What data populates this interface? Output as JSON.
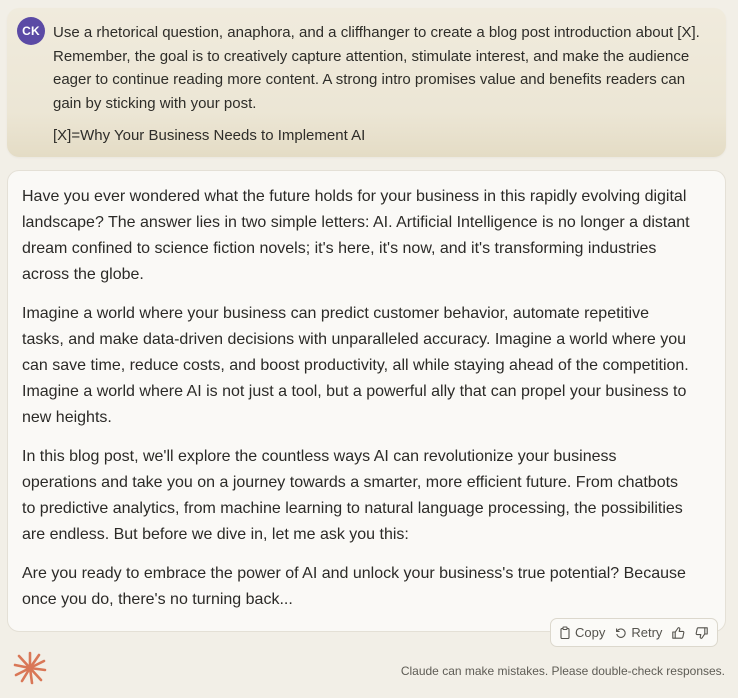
{
  "user": {
    "initials": "CK",
    "paragraphs": [
      "Use a rhetorical question, anaphora, and a cliffhanger to create a blog post introduction about [X]. Remember, the goal is to creatively capture attention, stimulate interest, and make the audience eager to continue reading more content. A strong intro promises value and benefits readers can gain by sticking with your post.",
      "[X]=Why Your Business Needs to Implement AI"
    ]
  },
  "assistant": {
    "paragraphs": [
      "Have you ever wondered what the future holds for your business in this rapidly evolving digital landscape? The answer lies in two simple letters: AI. Artificial Intelligence is no longer a distant dream confined to science fiction novels; it's here, it's now, and it's transforming industries across the globe.",
      "Imagine a world where your business can predict customer behavior, automate repetitive tasks, and make data-driven decisions with unparalleled accuracy. Imagine a world where you can save time, reduce costs, and boost productivity, all while staying ahead of the competition. Imagine a world where AI is not just a tool, but a powerful ally that can propel your business to new heights.",
      "In this blog post, we'll explore the countless ways AI can revolutionize your business operations and take you on a journey towards a smarter, more efficient future. From chatbots to predictive analytics, from machine learning to natural language processing, the possibilities are endless. But before we dive in, let me ask you this:",
      "Are you ready to embrace the power of AI and unlock your business's true potential? Because once you do, there's no turning back..."
    ]
  },
  "actions": {
    "copy_label": "Copy",
    "retry_label": "Retry",
    "copy_icon": "clipboard-icon",
    "retry_icon": "refresh-icon",
    "thumbs_up_icon": "thumbs-up-icon",
    "thumbs_down_icon": "thumbs-down-icon"
  },
  "footer": {
    "disclaimer": "Claude can make mistakes. Please double-check responses.",
    "logo_icon": "claude-logo-icon"
  },
  "colors": {
    "avatar_bg": "#5b4aa5",
    "logo": "#d97757",
    "page_bg": "#f2efe7"
  }
}
